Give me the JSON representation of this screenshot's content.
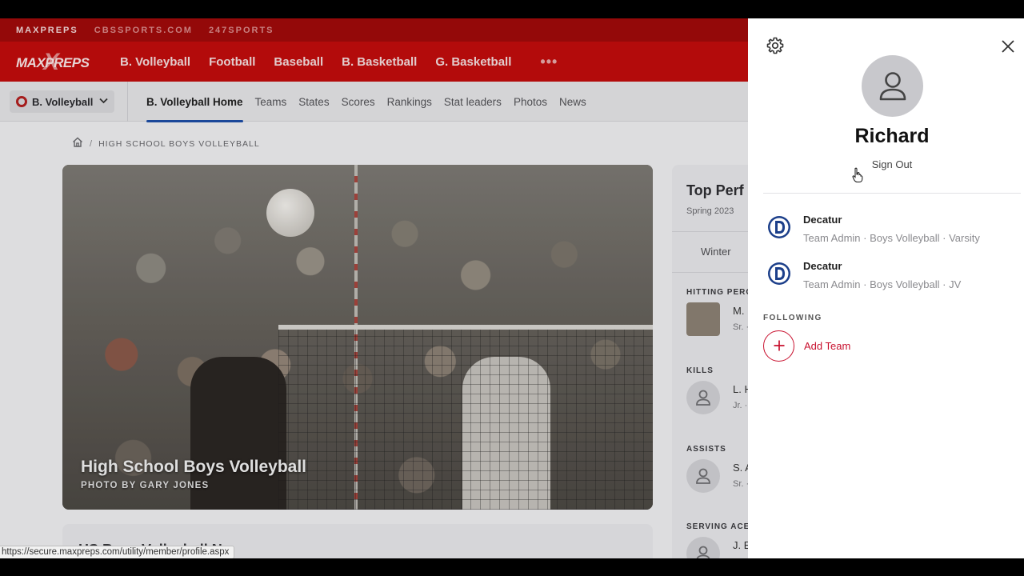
{
  "top_strip": {
    "links": [
      "MAXPREPS",
      "CBSSPORTS.COM",
      "247SPORTS"
    ]
  },
  "main_nav": {
    "logo_text": "MAXPREPS",
    "items": [
      "B. Volleyball",
      "Football",
      "Baseball",
      "B. Basketball",
      "G. Basketball"
    ],
    "more_label": "•••"
  },
  "sub_nav": {
    "sport_selector": "B. Volleyball",
    "links": [
      "B. Volleyball Home",
      "Teams",
      "States",
      "Scores",
      "Rankings",
      "Stat leaders",
      "Photos",
      "News"
    ],
    "active_index": 0
  },
  "breadcrumb": {
    "current": "HIGH SCHOOL BOYS VOLLEYBALL"
  },
  "hero": {
    "title": "High School Boys Volleyball",
    "credit": "PHOTO BY GARY JONES"
  },
  "news_card": {
    "title": "HS Boys Volleyball Ne"
  },
  "top_performers": {
    "title": "Top Perf",
    "subtitle": "Spring 2023",
    "season_tab": "Winter",
    "categories": [
      {
        "heading": "HITTING PERC",
        "name": "M.",
        "meta": "Sr. ·"
      },
      {
        "heading": "KILLS",
        "name": "L. H",
        "meta": "Jr. ·"
      },
      {
        "heading": "ASSISTS",
        "name": "S. A",
        "meta": "Sr. ·"
      },
      {
        "heading": "SERVING ACE",
        "name": "J. E",
        "meta": ""
      }
    ]
  },
  "status_bar": {
    "url": "https://secure.maxpreps.com/utility/member/profile.aspx"
  },
  "account_panel": {
    "user_name": "Richard",
    "sign_out_label": "Sign Out",
    "teams": [
      {
        "name": "Decatur",
        "role": "Team Admin · Boys Volleyball · Varsity"
      },
      {
        "name": "Decatur",
        "role": "Team Admin · Boys Volleyball · JV"
      }
    ],
    "following_label": "FOLLOWING",
    "add_team_label": "Add Team"
  },
  "colors": {
    "brand_red": "#c30d0d",
    "dark_red": "#a10a0a",
    "accent_blue": "#1e4fa8",
    "add_team_red": "#c8102e"
  }
}
